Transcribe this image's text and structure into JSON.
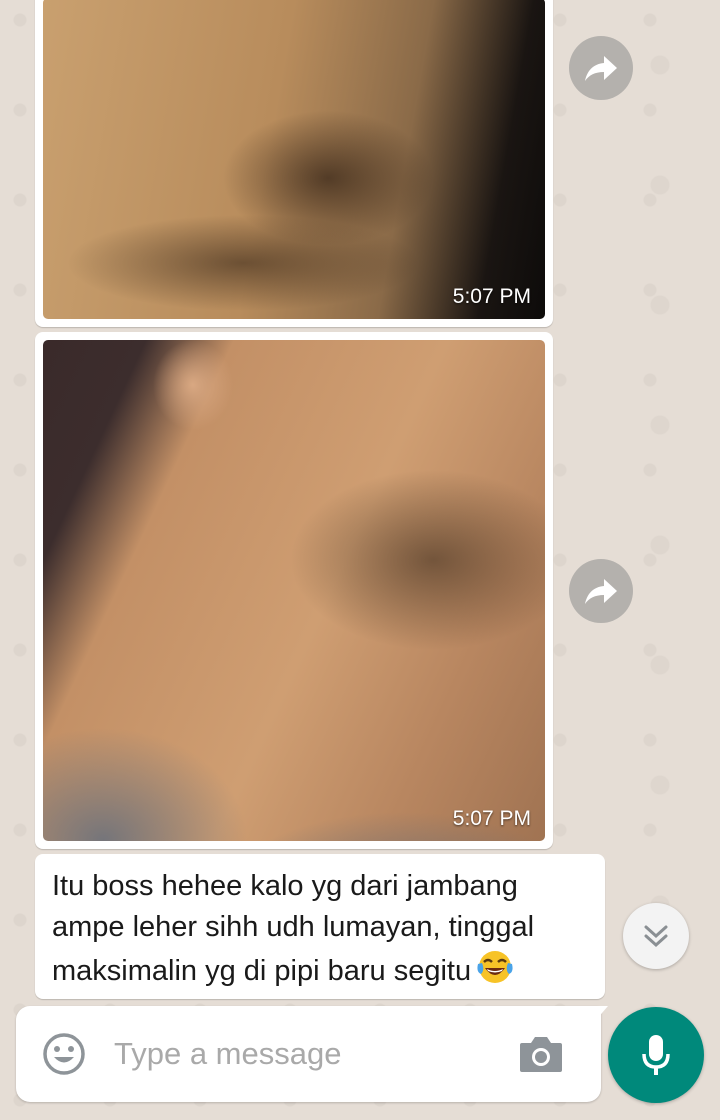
{
  "chat": {
    "messages": [
      {
        "type": "image",
        "time": "5:07 PM"
      },
      {
        "type": "image",
        "time": "5:07 PM"
      },
      {
        "type": "text",
        "lines": [
          "Itu boss hehee kalo yg dari jambang",
          "ampe leher sihh udh lumayan, tinggal",
          "maksimalin yg di pipi baru segitu"
        ],
        "emoji": "face-with-tears-of-joy"
      }
    ]
  },
  "composer": {
    "placeholder": "Type a message"
  },
  "icons": {
    "forward": "forward-icon",
    "scroll_down": "chevron-double-down-icon",
    "emoji": "smiley-icon",
    "camera": "camera-icon",
    "mic": "mic-icon"
  },
  "colors": {
    "wallpaper": "#e5ddd5",
    "bubble": "#ffffff",
    "mic_button": "#00897b",
    "placeholder": "#a9a9a9"
  }
}
